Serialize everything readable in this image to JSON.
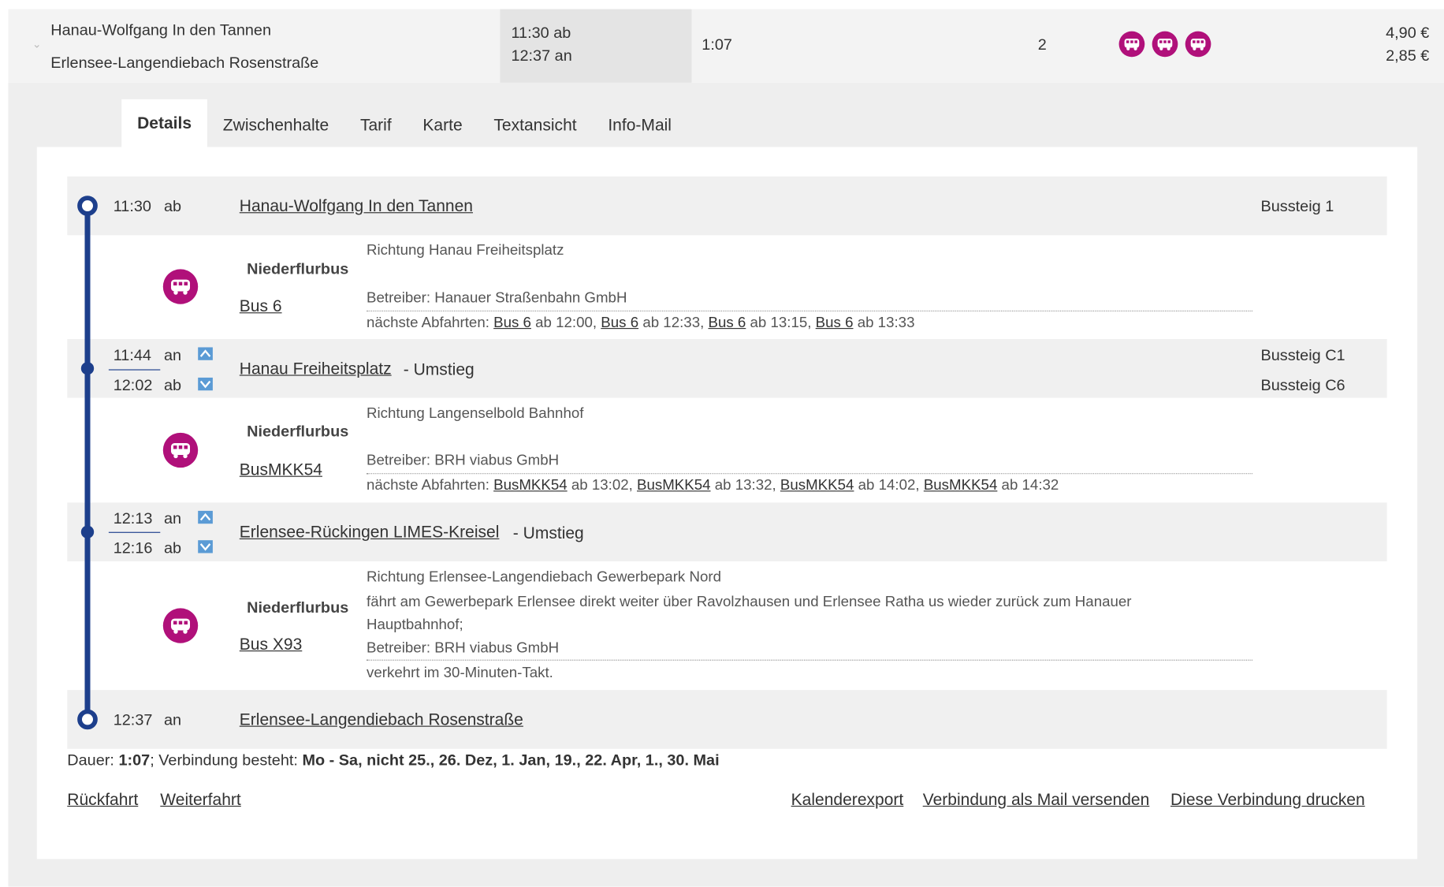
{
  "summary": {
    "from": "Hanau-Wolfgang In den Tannen",
    "to": "Erlensee-Langendiebach Rosenstraße",
    "dep": "11:30 ab",
    "arr": "12:37 an",
    "duration": "1:07",
    "changes": "2",
    "price1": "4,90 €",
    "price2": "2,85 €",
    "icons": [
      "bus-icon",
      "bus-icon",
      "bus-icon"
    ]
  },
  "tabs": [
    "Details",
    "Zwischenhalte",
    "Tarif",
    "Karte",
    "Textansicht",
    "Info-Mail"
  ],
  "stops": [
    {
      "time": "11:30",
      "type": "ab",
      "name": "Hanau-Wolfgang In den Tannen",
      "suffix": "",
      "platform": "Bussteig 1"
    },
    {
      "time_an": "11:44",
      "an": "an",
      "time_ab": "12:02",
      "ab": "ab",
      "name": "Hanau Freiheitsplatz",
      "suffix": "- Umstieg",
      "platform_an": "Bussteig C1",
      "platform_ab": "Bussteig C6"
    },
    {
      "time_an": "12:13",
      "an": "an",
      "time_ab": "12:16",
      "ab": "ab",
      "name": "Erlensee-Rückingen LIMES-Kreisel",
      "suffix": "- Umstieg"
    },
    {
      "time": "12:37",
      "type": "an",
      "name": "Erlensee-Langendiebach Rosenstraße"
    }
  ],
  "legs": [
    {
      "product": "Niederflurbus",
      "line": "Bus 6",
      "direction": "Richtung Hanau Freiheitsplatz",
      "operator": "Betreiber: BRH viabus GmbH",
      "next_label": "nächste Abfahrten:",
      "next": [
        {
          "line": "Bus 6",
          "at": "ab 12:00,"
        },
        {
          "line": "Bus 6",
          "at": "ab 12:33,"
        },
        {
          "line": "Bus 6",
          "at": "ab 13:15,"
        },
        {
          "line": "Bus 6",
          "at": "ab 13:33"
        }
      ]
    },
    {
      "product": "Niederflurbus",
      "line": "BusMKK54",
      "direction": "Richtung Langenselbold Bahnhof",
      "operator": "Betreiber: BRH viabus GmbH",
      "next_label": "nächste Abfahrten:",
      "next": [
        {
          "line": "BusMKK54",
          "at": "ab 13:02,"
        },
        {
          "line": "BusMKK54",
          "at": "ab 13:32,"
        },
        {
          "line": "BusMKK54",
          "at": "ab 14:02,"
        },
        {
          "line": "BusMKK54",
          "at": "ab 14:32"
        }
      ]
    },
    {
      "product": "Niederflurbus",
      "line": "Bus X93",
      "direction": "Richtung Erlensee-Langendiebach Gewerbepark Nord",
      "info1": "fährt am Gewerbepark Erlensee direkt weiter über Ravolzhausen und Erlensee Ratha us wieder zurück zum Hanauer",
      "info2": "Hauptbahnhof;",
      "operator": "Betreiber: BRH viabus GmbH",
      "note": "verkehrt im 30-Minuten-Takt."
    }
  ],
  "leg1_operator": "Betreiber: Hanauer Straßenbahn GmbH",
  "footer": {
    "dauer_label": "Dauer:",
    "dauer": "1:07",
    "verbindung_label": "; Verbindung besteht:",
    "verbindung": "Mo - Sa, nicht 25., 26. Dez, 1. Jan, 19., 22. Apr, 1., 30. Mai",
    "links": [
      "Rückfahrt",
      "Weiterfahrt",
      "Kalenderexport",
      "Verbindung als Mail versenden",
      "Diese Verbindung drucken"
    ]
  },
  "colors": {
    "accent": "#1d3f8c",
    "bus": "#b0107a"
  }
}
